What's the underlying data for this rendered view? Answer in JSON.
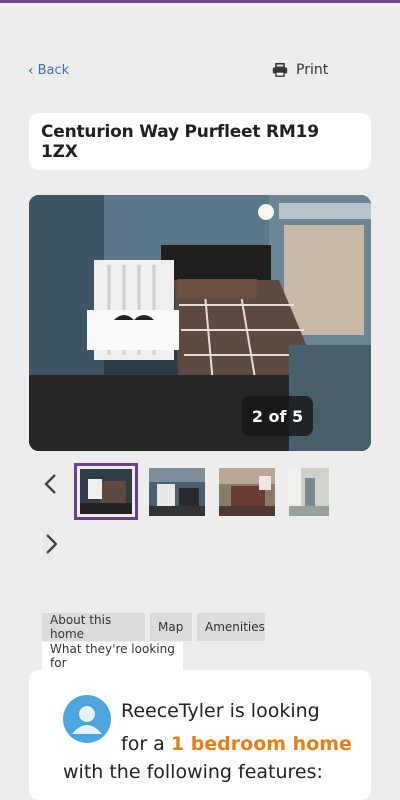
{
  "nav": {
    "back_label": "Back",
    "print_label": "Print"
  },
  "listing": {
    "address": "Centurion Way Purfleet RM19 1ZX"
  },
  "gallery": {
    "counter": "2 of 5"
  },
  "tabs": {
    "about": "About this home",
    "map": "Map",
    "amenities": "Amenities",
    "looking_for": "What they're looking for"
  },
  "looking": {
    "line1": "ReeceTyler is looking",
    "line2_prefix": "for a ",
    "line2_highlight": "1 bedroom home",
    "line3": "with the following features:"
  },
  "colors": {
    "accent": "#6b3f86",
    "link": "#3a6fb0",
    "highlight": "#e3801a"
  }
}
